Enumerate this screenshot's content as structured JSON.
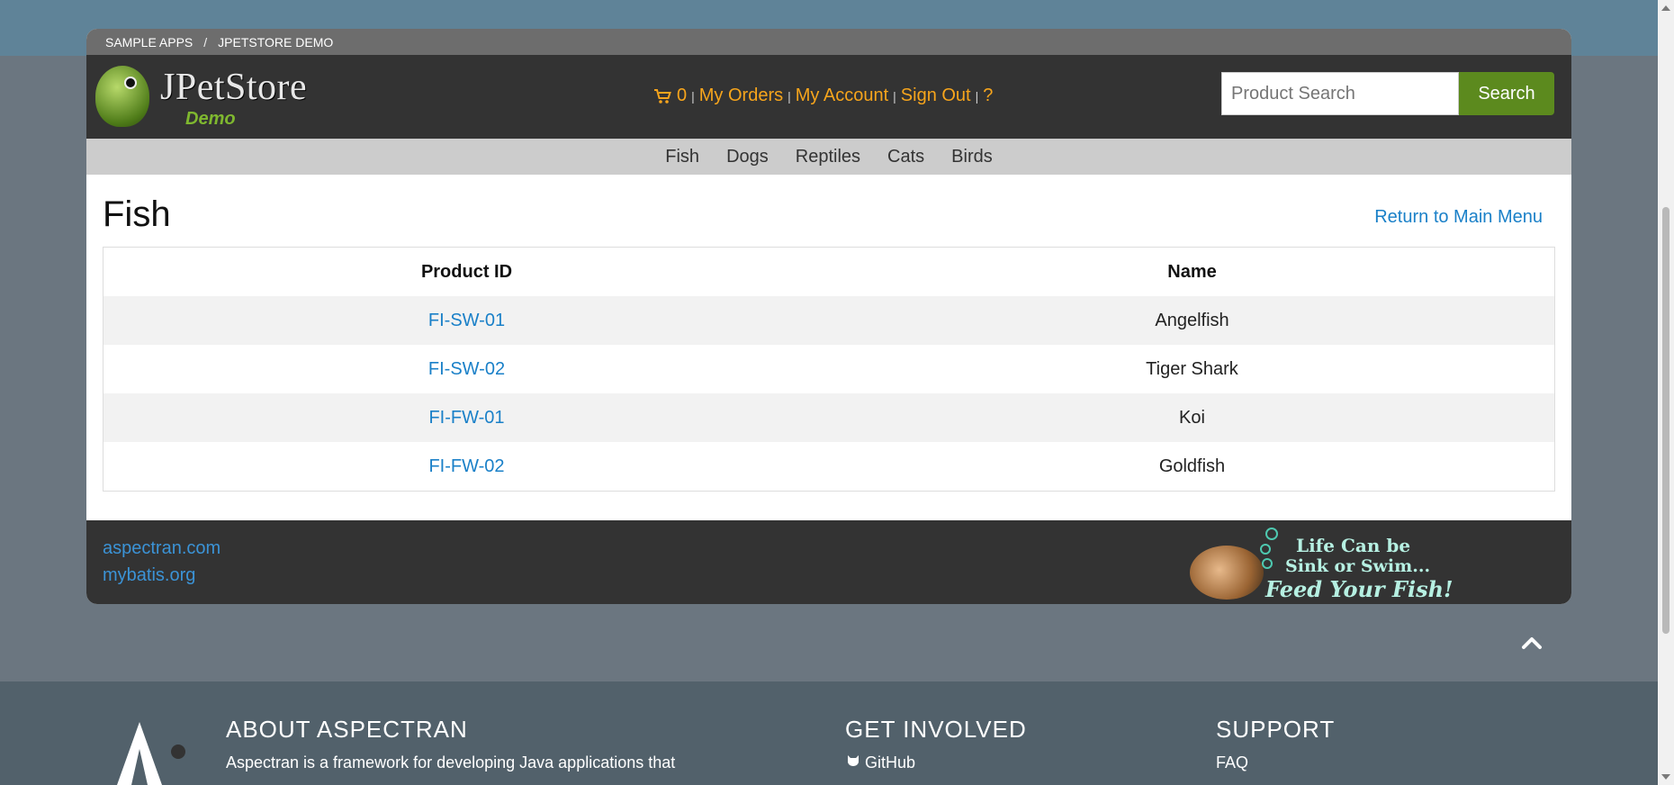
{
  "breadcrumb": {
    "items": [
      "SAMPLE APPS",
      "JPETSTORE DEMO"
    ],
    "separator": "/"
  },
  "logo": {
    "title": "JPetStore",
    "subtitle": "Demo"
  },
  "header_nav": {
    "cart_count": "0",
    "my_orders": "My Orders",
    "my_account": "My Account",
    "sign_out": "Sign Out",
    "help": "?"
  },
  "search": {
    "placeholder": "Product Search",
    "button": "Search"
  },
  "categories": [
    "Fish",
    "Dogs",
    "Reptiles",
    "Cats",
    "Birds"
  ],
  "main": {
    "title": "Fish",
    "return_link": "Return to Main Menu",
    "table": {
      "headers": [
        "Product ID",
        "Name"
      ],
      "rows": [
        {
          "id": "FI-SW-01",
          "name": "Angelfish"
        },
        {
          "id": "FI-SW-02",
          "name": "Tiger Shark"
        },
        {
          "id": "FI-FW-01",
          "name": "Koi"
        },
        {
          "id": "FI-FW-02",
          "name": "Goldfish"
        }
      ]
    }
  },
  "footer": {
    "links": [
      "aspectran.com",
      "mybatis.org"
    ],
    "ad": {
      "line1": "Life Can be",
      "line2": "Sink or Swim...",
      "line3": "Feed Your Fish!"
    }
  },
  "site_footer": {
    "about_title": "ABOUT ASPECTRAN",
    "about_text": "Aspectran is a framework for developing Java applications that",
    "involved_title": "GET INVOLVED",
    "github": "GitHub",
    "support_title": "SUPPORT",
    "faq": "FAQ"
  },
  "colors": {
    "accent_orange": "#f7a51c",
    "link_blue": "#1a80c8",
    "search_green": "#5c8a1e"
  }
}
